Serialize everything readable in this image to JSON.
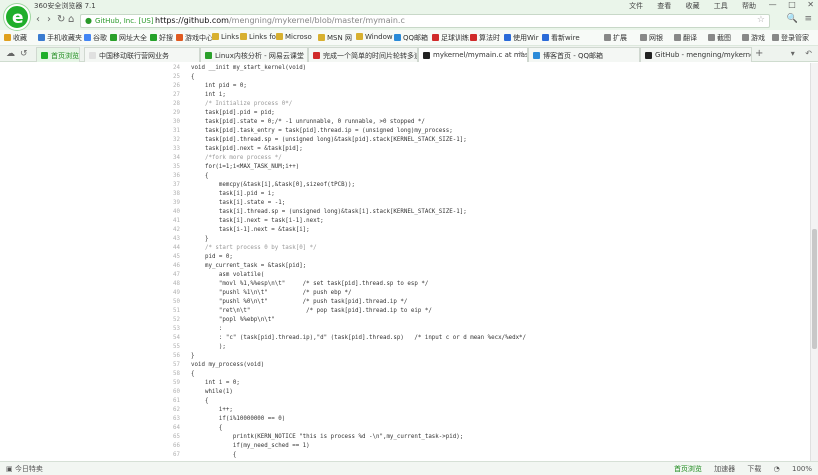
{
  "window": {
    "title": "360安全浏览器 7.1",
    "menu": [
      "文件",
      "查看",
      "收藏",
      "工具",
      "帮助"
    ],
    "controls": {
      "minimize": "—",
      "maximize": "□",
      "close": "✕"
    }
  },
  "nav": {
    "back": "‹",
    "forward": "›",
    "refresh": "↻",
    "home": "⌂",
    "cert": "GitHub, Inc. [US]",
    "url_host": "https://github.com",
    "url_path": "/mengning/mykernel/blob/master/mymain.c",
    "star": "☆",
    "search": "🔍",
    "more": "≡"
  },
  "bookmarks": {
    "left": [
      {
        "label": "收藏",
        "color": "#e0a020"
      },
      {
        "label": "手机收藏夹",
        "color": "#3a7ad0"
      },
      {
        "label": "谷歌",
        "color": "#4285f4"
      },
      {
        "label": "网址大全",
        "color": "#2aa02a"
      },
      {
        "label": "好搜",
        "color": "#25a22a"
      },
      {
        "label": "游戏中心",
        "color": "#e05a20"
      },
      {
        "label": "Links",
        "color": "#d8b030"
      },
      {
        "label": "Links for",
        "color": "#d8b030"
      },
      {
        "label": "Microso",
        "color": "#d8b030"
      },
      {
        "label": "MSN 网",
        "color": "#d8b030"
      },
      {
        "label": "Window",
        "color": "#d8b030"
      },
      {
        "label": "QQ邮箱",
        "color": "#2a8ad8"
      },
      {
        "label": "足球训练",
        "color": "#d02a2a"
      },
      {
        "label": "算法时",
        "color": "#d02a2a"
      },
      {
        "label": "使用Wir",
        "color": "#2a6ad8"
      },
      {
        "label": "看新wire",
        "color": "#2a6ad8"
      }
    ],
    "right": [
      {
        "label": "扩展",
        "color": "#888888"
      },
      {
        "label": "网银",
        "color": "#888888"
      },
      {
        "label": "翻译",
        "color": "#888888"
      },
      {
        "label": "截图",
        "color": "#888888"
      },
      {
        "label": "游戏",
        "color": "#888888"
      },
      {
        "label": "登录管家",
        "color": "#888888"
      }
    ]
  },
  "tabs": [
    {
      "label": "首页浏览",
      "color": "#1fae2a"
    },
    {
      "label": "中国移动联行营网业务",
      "color": "#e0e0e0"
    },
    {
      "label": "Linux内核分析 - 网易云课堂",
      "color": "#2aa02a"
    },
    {
      "label": "完成一个简单的时间片轮转多道",
      "color": "#d02a2a"
    },
    {
      "label": "mykernel/mymain.c at mast",
      "color": "#222222"
    },
    {
      "label": "博客首页 - QQ邮箱",
      "color": "#2a8ad8"
    },
    {
      "label": "GitHub - mengning/mykerne",
      "color": "#222222"
    }
  ],
  "new_tab": "+",
  "code": [
    {
      "n": "24",
      "t": "void __init my_start_kernel(void)"
    },
    {
      "n": "25",
      "t": "{"
    },
    {
      "n": "26",
      "t": "    int pid = 0;"
    },
    {
      "n": "27",
      "t": "    int i;"
    },
    {
      "n": "28",
      "t": "    /* Initialize process 0*/",
      "c": true
    },
    {
      "n": "29",
      "t": "    task[pid].pid = pid;"
    },
    {
      "n": "30",
      "t": "    task[pid].state = 0;/* -1 unrunnable, 0 runnable, >0 stopped */"
    },
    {
      "n": "31",
      "t": "    task[pid].task_entry = task[pid].thread.ip = (unsigned long)my_process;"
    },
    {
      "n": "32",
      "t": "    task[pid].thread.sp = (unsigned long)&task[pid].stack[KERNEL_STACK_SIZE-1];"
    },
    {
      "n": "33",
      "t": "    task[pid].next = &task[pid];"
    },
    {
      "n": "34",
      "t": "    /*fork more process */",
      "c": true
    },
    {
      "n": "35",
      "t": "    for(i=1;i<MAX_TASK_NUM;i++)"
    },
    {
      "n": "36",
      "t": "    {"
    },
    {
      "n": "37",
      "t": "        memcpy(&task[i],&task[0],sizeof(tPCB));"
    },
    {
      "n": "38",
      "t": "        task[i].pid = i;"
    },
    {
      "n": "39",
      "t": "        task[i].state = -1;"
    },
    {
      "n": "40",
      "t": "        task[i].thread.sp = (unsigned long)&task[i].stack[KERNEL_STACK_SIZE-1];"
    },
    {
      "n": "41",
      "t": "        task[i].next = task[i-1].next;"
    },
    {
      "n": "42",
      "t": "        task[i-1].next = &task[i];"
    },
    {
      "n": "43",
      "t": "    }"
    },
    {
      "n": "44",
      "t": "    /* start process 0 by task[0] */",
      "c": true
    },
    {
      "n": "45",
      "t": "    pid = 0;"
    },
    {
      "n": "46",
      "t": "    my_current_task = &task[pid];"
    },
    {
      "n": "47",
      "t": "        asm volatile("
    },
    {
      "n": "48",
      "t": "        \"movl %1,%%esp\\n\\t\"     /* set task[pid].thread.sp to esp */"
    },
    {
      "n": "49",
      "t": "        \"pushl %1\\n\\t\"          /* push ebp */"
    },
    {
      "n": "50",
      "t": "        \"pushl %0\\n\\t\"          /* push task[pid].thread.ip */"
    },
    {
      "n": "51",
      "t": "        \"ret\\n\\t\"                /* pop task[pid].thread.ip to eip */"
    },
    {
      "n": "52",
      "t": "        \"popl %%ebp\\n\\t\""
    },
    {
      "n": "53",
      "t": "        :"
    },
    {
      "n": "54",
      "t": "        : \"c\" (task[pid].thread.ip),\"d\" (task[pid].thread.sp)   /* input c or d mean %ecx/%edx*/"
    },
    {
      "n": "55",
      "t": "        );"
    },
    {
      "n": "56",
      "t": "}"
    },
    {
      "n": "57",
      "t": "void my_process(void)"
    },
    {
      "n": "58",
      "t": "{"
    },
    {
      "n": "59",
      "t": "    int i = 0;"
    },
    {
      "n": "60",
      "t": "    while(1)"
    },
    {
      "n": "61",
      "t": "    {"
    },
    {
      "n": "62",
      "t": "        i++;"
    },
    {
      "n": "63",
      "t": "        if(i%10000000 == 0)"
    },
    {
      "n": "64",
      "t": "        {"
    },
    {
      "n": "65",
      "t": "            printk(KERN_NOTICE \"this is process %d -\\n\",my_current_task->pid);"
    },
    {
      "n": "66",
      "t": "            if(my_need_sched == 1)"
    },
    {
      "n": "67",
      "t": "            {"
    }
  ],
  "status": {
    "left": "今日特卖",
    "right": [
      "首页浏览",
      "加速器",
      "下载",
      "",
      "100%"
    ]
  },
  "colors": {
    "brand": "#1fae2a",
    "chrome_bg": "#eaf5ea"
  }
}
